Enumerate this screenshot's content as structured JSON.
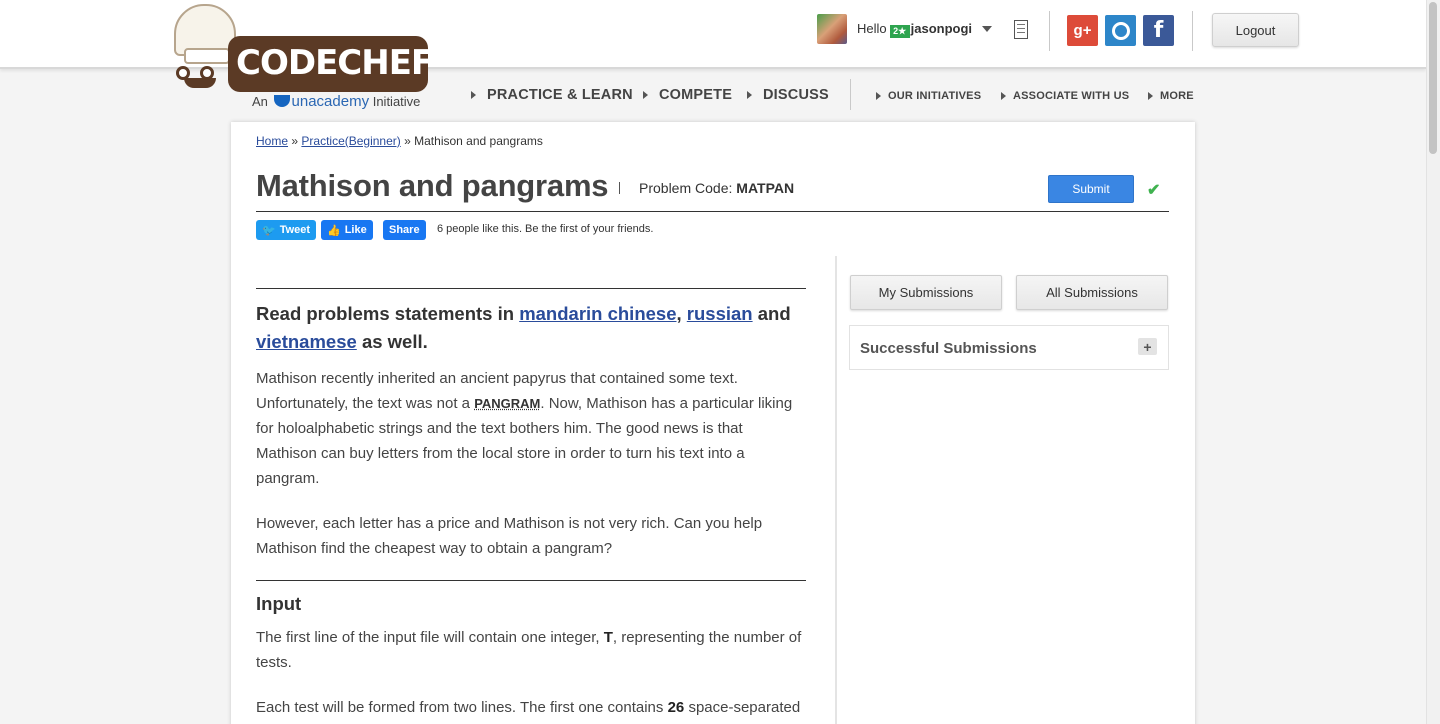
{
  "brand": {
    "logo_text": "CODECHEF",
    "tagline_prefix": "An",
    "tagline_brand": "unacademy",
    "tagline_suffix": "Initiative"
  },
  "user": {
    "greeting": "Hello",
    "badge": "2★",
    "username": "jasonpogi"
  },
  "header": {
    "social": {
      "gplus": "g+",
      "facebook": "f"
    },
    "logout_label": "Logout"
  },
  "nav": {
    "primary": [
      "PRACTICE & LEARN",
      "COMPETE",
      "DISCUSS"
    ],
    "secondary": [
      "OUR INITIATIVES",
      "ASSOCIATE WITH US",
      "MORE"
    ]
  },
  "breadcrumb": {
    "home": "Home",
    "sep1": "»",
    "practice": "Practice(Beginner)",
    "sep2": "»",
    "current": "Mathison and pangrams"
  },
  "problem": {
    "title": "Mathison and pangrams",
    "code_label": "Problem Code:",
    "code": "MATPAN",
    "submit_label": "Submit",
    "check": "✔"
  },
  "share": {
    "tweet": "Tweet",
    "like": "Like",
    "share": "Share",
    "likes_text": "6 people like this. Be the first of your friends."
  },
  "statement": {
    "lang_intro": "Read problems statements in",
    "lang_1": "mandarin chinese",
    "lang_sep": ",",
    "lang_2": "russian",
    "lang_and": "and",
    "lang_3": "vietnamese",
    "lang_outro": "as well.",
    "p1_a": "Mathison recently inherited an ancient papyrus that contained some text. Unfortunately, the text was not a",
    "p1_term": "PANGRAM",
    "p1_b": ". Now, Mathison has a particular liking for holoalphabetic strings and the text bothers him. The good news is that Mathison can buy letters from the local store in order to turn his text into a pangram.",
    "p2": "However, each letter has a price and Mathison is not very rich. Can you help Mathison find the cheapest way to obtain a pangram?",
    "input_heading": "Input",
    "p3_a": "The first line of the input file will contain one integer,",
    "p3_var": "T",
    "p3_b": ", representing the number of tests.",
    "p4_a": "Each test will be formed from two lines. The first one contains",
    "p4_num": "26",
    "p4_b": "space-separated"
  },
  "sidebar": {
    "my_submissions": "My Submissions",
    "all_submissions": "All Submissions",
    "successful_submissions": "Successful Submissions",
    "expand": "+"
  }
}
